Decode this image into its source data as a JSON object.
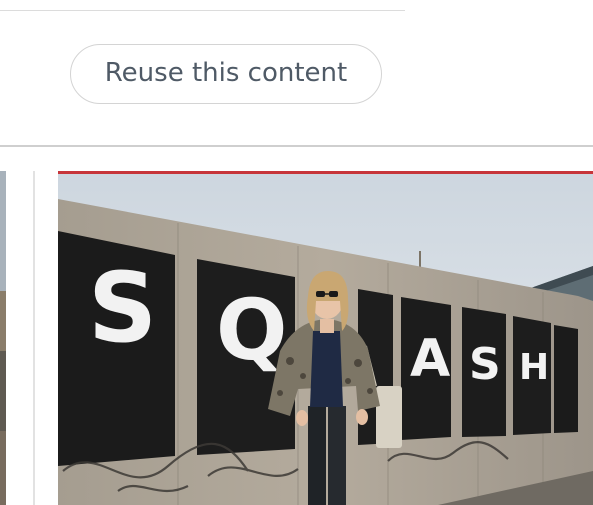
{
  "reuse": {
    "button_label": "Reuse this content"
  },
  "photo": {
    "poster_letters": [
      "S",
      "Q",
      "A",
      "S",
      "H"
    ],
    "accent_color": "#c7353a"
  },
  "icons": {
    "left_tile": "image-thumbnail",
    "main_photo": "photo-image"
  }
}
